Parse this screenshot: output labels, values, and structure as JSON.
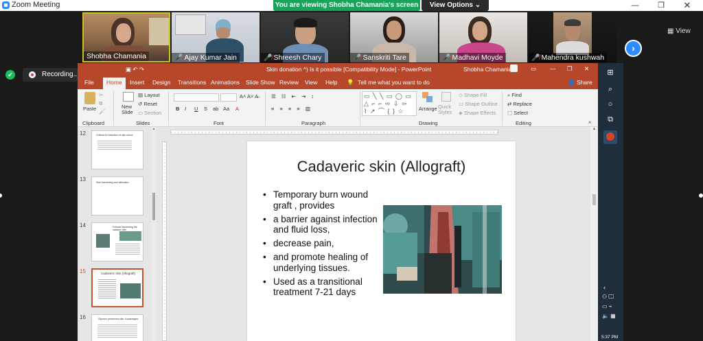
{
  "zoom": {
    "window_title": "Zoom Meeting",
    "viewing_banner": "You are viewing Shobha Chamania's screen",
    "view_options": "View Options ⌄",
    "view_button": "View",
    "recording_label": "Recording..."
  },
  "participants": [
    {
      "name": "Shobha Chamania",
      "muted": false
    },
    {
      "name": "Ajay Kumar Jain",
      "muted": true
    },
    {
      "name": "Shreesh Chary",
      "muted": true
    },
    {
      "name": "Sanskriti Tare",
      "muted": true
    },
    {
      "name": "Madhavi Moyde",
      "muted": true
    },
    {
      "name": "Mahendra kushwah",
      "muted": true
    }
  ],
  "ppt": {
    "title": "Skin donation ^) Is it possible [Compatibility Mode] - PowerPoint",
    "user": "Shobha Chamania",
    "tabs": [
      "File",
      "Home",
      "Insert",
      "Design",
      "Transitions",
      "Animations",
      "Slide Show",
      "Review",
      "View",
      "Help"
    ],
    "tell_me": "Tell me what you want to do",
    "share": "Share",
    "ribbon": {
      "paste": "Paste",
      "new_slide": "New Slide",
      "layout": "Layout",
      "reset": "Reset",
      "section": "Section",
      "arrange": "Arrange",
      "quick_styles": "Quick Styles",
      "shape_fill": "Shape Fill",
      "shape_outline": "Shape Outline",
      "shape_effects": "Shape Effects",
      "find": "Find",
      "replace": "Replace",
      "select": "Select",
      "groups": [
        "Clipboard",
        "Slides",
        "Font",
        "Paragraph",
        "Drawing",
        "Editing"
      ]
    },
    "thumbnails": [
      {
        "num": "12",
        "text": "Criteria for selection of skin donor"
      },
      {
        "num": "13",
        "text": "Skin harvesting and utilization"
      },
      {
        "num": "14",
        "text": "Follows harvesting the cadaver skin"
      },
      {
        "num": "15",
        "text": "Cadaveric skin (Allograft)"
      },
      {
        "num": "16",
        "text": "Glycerol preserved skin: Advantages"
      }
    ],
    "slide": {
      "title": "Cadaveric skin (Allograft)",
      "bullets": [
        "Temporary burn wound graft , provides",
        " a barrier against infection and fluid loss,",
        "decrease pain,",
        "and promote healing of underlying tissues.",
        "Used as a transitional treatment 7-21 days"
      ]
    }
  },
  "taskbar": {
    "time": "5:37 PM"
  }
}
